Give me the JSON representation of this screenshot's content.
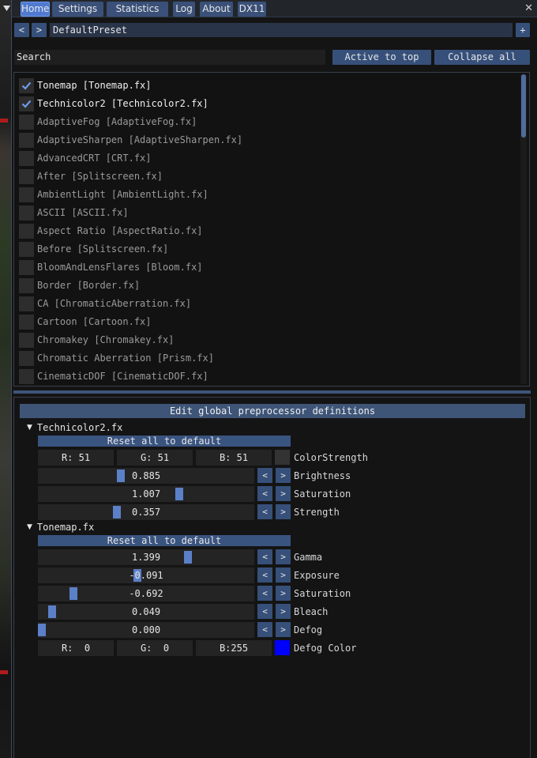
{
  "tabs": [
    "Home",
    "Settings",
    "Statistics",
    "Log",
    "About",
    "DX11"
  ],
  "close_label": "✕",
  "preset": {
    "prev": "<",
    "next": ">",
    "name": "DefaultPreset",
    "add": "+"
  },
  "search": {
    "placeholder": "Search"
  },
  "active_to_top_label": "Active to top",
  "collapse_all_label": "Collapse all",
  "effects": [
    {
      "label": "Tonemap [Tonemap.fx]",
      "checked": true
    },
    {
      "label": "Technicolor2 [Technicolor2.fx]",
      "checked": true
    },
    {
      "label": "AdaptiveFog [AdaptiveFog.fx]",
      "checked": false
    },
    {
      "label": "AdaptiveSharpen [AdaptiveSharpen.fx]",
      "checked": false
    },
    {
      "label": "AdvancedCRT [CRT.fx]",
      "checked": false
    },
    {
      "label": "After [Splitscreen.fx]",
      "checked": false
    },
    {
      "label": "AmbientLight [AmbientLight.fx]",
      "checked": false
    },
    {
      "label": "ASCII [ASCII.fx]",
      "checked": false
    },
    {
      "label": "Aspect Ratio [AspectRatio.fx]",
      "checked": false
    },
    {
      "label": "Before [Splitscreen.fx]",
      "checked": false
    },
    {
      "label": "BloomAndLensFlares [Bloom.fx]",
      "checked": false
    },
    {
      "label": "Border [Border.fx]",
      "checked": false
    },
    {
      "label": "CA [ChromaticAberration.fx]",
      "checked": false
    },
    {
      "label": "Cartoon [Cartoon.fx]",
      "checked": false
    },
    {
      "label": "Chromakey [Chromakey.fx]",
      "checked": false
    },
    {
      "label": "Chromatic Aberration [Prism.fx]",
      "checked": false
    },
    {
      "label": "CinematicDOF [CinematicDOF.fx]",
      "checked": false
    }
  ],
  "list_scroll_fraction": 0.0,
  "edit_global_label": "Edit global preprocessor definitions",
  "arrow_left": "<",
  "arrow_right": ">",
  "sections": [
    {
      "title": "Technicolor2.fx",
      "reset_label": "Reset all to default",
      "color": {
        "r": "R: 51",
        "g": "G: 51",
        "b": "B: 51",
        "name": "ColorStrength",
        "swatch": "#333333"
      },
      "sliders": [
        {
          "value": "0.885",
          "name": "Brightness",
          "fraction": 0.38
        },
        {
          "value": "1.007",
          "name": "Saturation",
          "fraction": 0.66
        },
        {
          "value": "0.357",
          "name": "Strength",
          "fraction": 0.36
        }
      ]
    },
    {
      "title": "Tonemap.fx",
      "reset_label": "Reset all to default",
      "sliders": [
        {
          "value": "1.399",
          "name": "Gamma",
          "fraction": 0.7
        },
        {
          "value": "-0.091",
          "name": "Exposure",
          "fraction": 0.46
        },
        {
          "value": "-0.692",
          "name": "Saturation",
          "fraction": 0.15
        },
        {
          "value": "0.049",
          "name": "Bleach",
          "fraction": 0.05
        },
        {
          "value": "0.000",
          "name": "Defog",
          "fraction": 0.0
        }
      ],
      "color": {
        "r": "R:  0",
        "g": "G:  0",
        "b": "B:255",
        "name": "Defog Color",
        "swatch": "#0000ff"
      }
    }
  ]
}
